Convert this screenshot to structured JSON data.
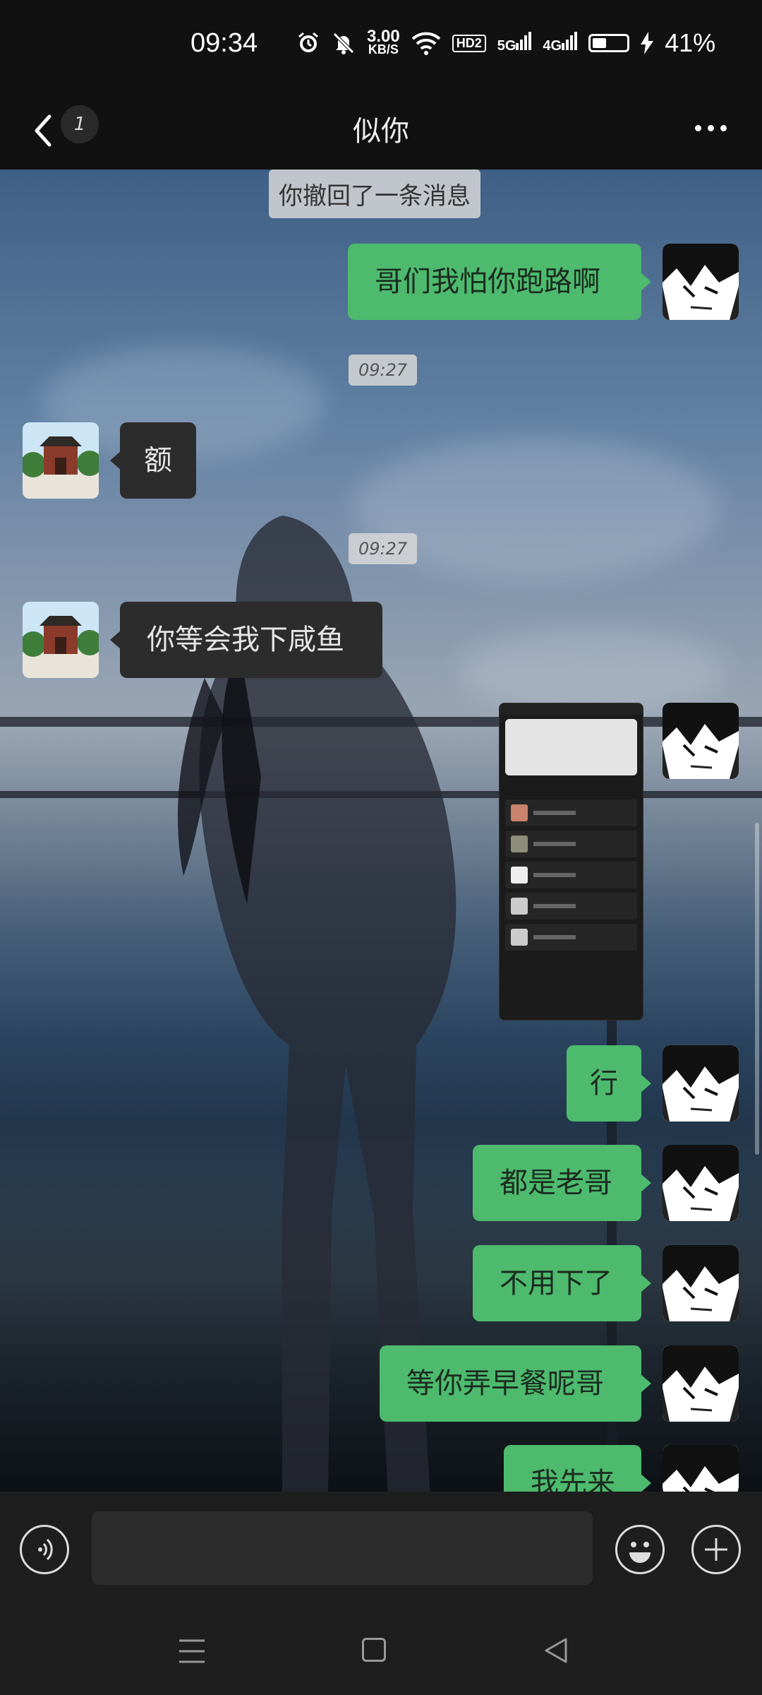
{
  "status_bar": {
    "time": "09:34",
    "net_speed_value": "3.00",
    "net_speed_unit": "KB/S",
    "hd_badge": "HD2",
    "signal1": "5G",
    "signal2": "4G",
    "battery_percent": "41%",
    "battery_level": 0.41,
    "charging": true,
    "icons": [
      "alarm-icon",
      "mute-icon",
      "wifi-icon",
      "signal-icon",
      "battery-icon",
      "charging-icon"
    ]
  },
  "header": {
    "unread_count": "1",
    "title": "似你",
    "icons": [
      "back-icon",
      "more-icon"
    ]
  },
  "messages": {
    "recalled": "你撤回了一条消息",
    "m1": "哥们我怕你跑路啊",
    "ts1": "09:27",
    "m2": "额",
    "ts2": "09:27",
    "m3": "你等会我下咸鱼",
    "m4": "行",
    "m5": "都是老哥",
    "m6": "不用下了",
    "m7": "等你弄早餐呢哥",
    "m8": "我先来"
  },
  "input_bar": {
    "placeholder": "",
    "icons": [
      "voice-icon",
      "emoji-icon",
      "plus-icon"
    ]
  },
  "nav_bar": {
    "icons": [
      "menu-icon",
      "home-icon",
      "back-triangle-icon"
    ]
  },
  "colors": {
    "my_bubble": "#4dba6e",
    "their_bubble": "#2c2c2c",
    "bar_bg": "#1e1e1e"
  }
}
